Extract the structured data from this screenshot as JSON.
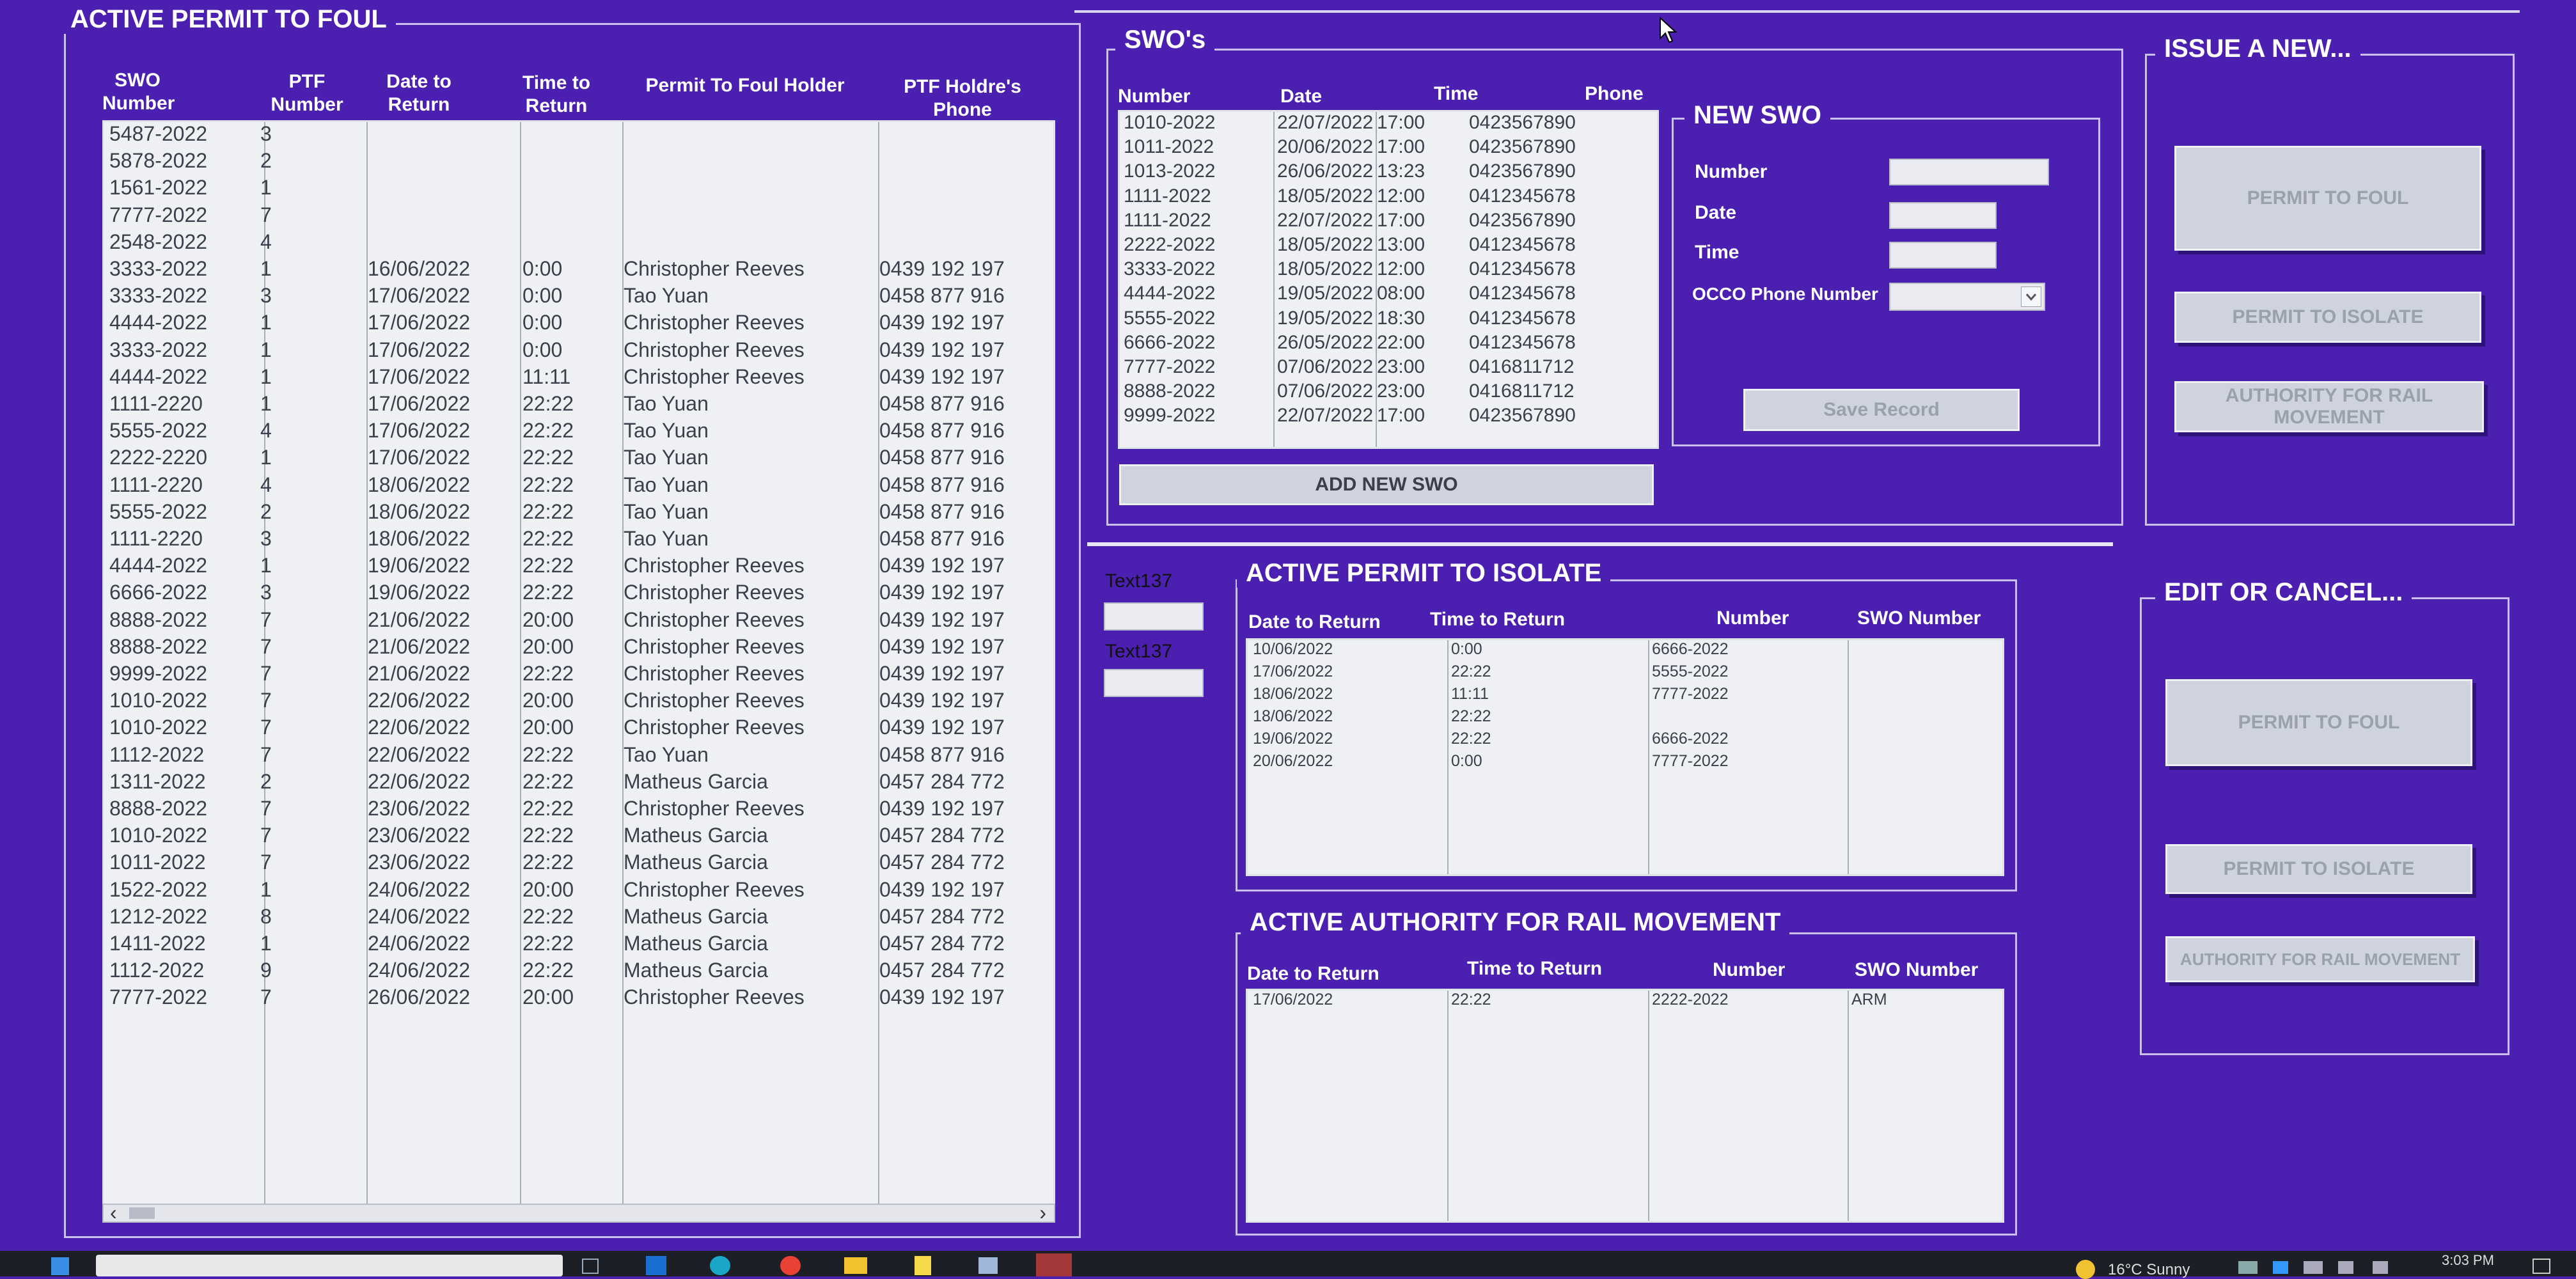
{
  "ptf": {
    "title": "ACTIVE PERMIT TO FOUL",
    "headers": [
      "SWO Number",
      "PTF Number",
      "Date to Return",
      "Time to Return",
      "Permit To Foul Holder",
      "PTF Holdre's Phone"
    ],
    "rows": [
      [
        "5487-2022",
        "3",
        "",
        "",
        "",
        ""
      ],
      [
        "5878-2022",
        "2",
        "",
        "",
        "",
        ""
      ],
      [
        "1561-2022",
        "1",
        "",
        "",
        "",
        ""
      ],
      [
        "7777-2022",
        "7",
        "",
        "",
        "",
        ""
      ],
      [
        "2548-2022",
        "4",
        "",
        "",
        "",
        ""
      ],
      [
        "3333-2022",
        "1",
        "16/06/2022",
        "0:00",
        "Christopher Reeves",
        "0439 192 197"
      ],
      [
        "3333-2022",
        "3",
        "17/06/2022",
        "0:00",
        "Tao Yuan",
        "0458 877 916"
      ],
      [
        "4444-2022",
        "1",
        "17/06/2022",
        "0:00",
        "Christopher Reeves",
        "0439 192 197"
      ],
      [
        "3333-2022",
        "1",
        "17/06/2022",
        "0:00",
        "Christopher Reeves",
        "0439 192 197"
      ],
      [
        "4444-2022",
        "1",
        "17/06/2022",
        "11:11",
        "Christopher Reeves",
        "0439 192 197"
      ],
      [
        "1111-2220",
        "1",
        "17/06/2022",
        "22:22",
        "Tao Yuan",
        "0458 877 916"
      ],
      [
        "5555-2022",
        "4",
        "17/06/2022",
        "22:22",
        "Tao Yuan",
        "0458 877 916"
      ],
      [
        "2222-2220",
        "1",
        "17/06/2022",
        "22:22",
        "Tao Yuan",
        "0458 877 916"
      ],
      [
        "1111-2220",
        "4",
        "18/06/2022",
        "22:22",
        "Tao Yuan",
        "0458 877 916"
      ],
      [
        "5555-2022",
        "2",
        "18/06/2022",
        "22:22",
        "Tao Yuan",
        "0458 877 916"
      ],
      [
        "1111-2220",
        "3",
        "18/06/2022",
        "22:22",
        "Tao Yuan",
        "0458 877 916"
      ],
      [
        "4444-2022",
        "1",
        "19/06/2022",
        "22:22",
        "Christopher Reeves",
        "0439 192 197"
      ],
      [
        "6666-2022",
        "3",
        "19/06/2022",
        "22:22",
        "Christopher Reeves",
        "0439 192 197"
      ],
      [
        "8888-2022",
        "7",
        "21/06/2022",
        "20:00",
        "Christopher Reeves",
        "0439 192 197"
      ],
      [
        "8888-2022",
        "7",
        "21/06/2022",
        "20:00",
        "Christopher Reeves",
        "0439 192 197"
      ],
      [
        "9999-2022",
        "7",
        "21/06/2022",
        "22:22",
        "Christopher Reeves",
        "0439 192 197"
      ],
      [
        "1010-2022",
        "7",
        "22/06/2022",
        "20:00",
        "Christopher Reeves",
        "0439 192 197"
      ],
      [
        "1010-2022",
        "7",
        "22/06/2022",
        "20:00",
        "Christopher Reeves",
        "0439 192 197"
      ],
      [
        "1112-2022",
        "7",
        "22/06/2022",
        "22:22",
        "Tao Yuan",
        "0458 877 916"
      ],
      [
        "1311-2022",
        "2",
        "22/06/2022",
        "22:22",
        "Matheus Garcia",
        "0457 284 772"
      ],
      [
        "8888-2022",
        "7",
        "23/06/2022",
        "22:22",
        "Christopher Reeves",
        "0439 192 197"
      ],
      [
        "1010-2022",
        "7",
        "23/06/2022",
        "22:22",
        "Matheus Garcia",
        "0457 284 772"
      ],
      [
        "1011-2022",
        "7",
        "23/06/2022",
        "22:22",
        "Matheus Garcia",
        "0457 284 772"
      ],
      [
        "1522-2022",
        "1",
        "24/06/2022",
        "20:00",
        "Christopher Reeves",
        "0439 192 197"
      ],
      [
        "1212-2022",
        "8",
        "24/06/2022",
        "22:22",
        "Matheus Garcia",
        "0457 284 772"
      ],
      [
        "1411-2022",
        "1",
        "24/06/2022",
        "22:22",
        "Matheus Garcia",
        "0457 284 772"
      ],
      [
        "1112-2022",
        "9",
        "24/06/2022",
        "22:22",
        "Matheus Garcia",
        "0457 284 772"
      ],
      [
        "7777-2022",
        "7",
        "26/06/2022",
        "20:00",
        "Christopher Reeves",
        "0439 192 197"
      ]
    ],
    "scroll_left": "‹",
    "scroll_right": "›"
  },
  "swo": {
    "title": "SWO's",
    "headers": [
      "Number",
      "Date",
      "Time",
      "Phone"
    ],
    "rows": [
      [
        "1010-2022",
        "22/07/2022",
        "17:00",
        "0423567890"
      ],
      [
        "1011-2022",
        "20/06/2022",
        "17:00",
        "0423567890"
      ],
      [
        "1013-2022",
        "26/06/2022",
        "13:23",
        "0423567890"
      ],
      [
        "1111-2022",
        "18/05/2022",
        "12:00",
        "0412345678"
      ],
      [
        "1111-2022",
        "22/07/2022",
        "17:00",
        "0423567890"
      ],
      [
        "2222-2022",
        "18/05/2022",
        "13:00",
        "0412345678"
      ],
      [
        "3333-2022",
        "18/05/2022",
        "12:00",
        "0412345678"
      ],
      [
        "4444-2022",
        "19/05/2022",
        "08:00",
        "0412345678"
      ],
      [
        "5555-2022",
        "19/05/2022",
        "18:30",
        "0412345678"
      ],
      [
        "6666-2022",
        "26/05/2022",
        "22:00",
        "0412345678"
      ],
      [
        "7777-2022",
        "07/06/2022",
        "23:00",
        "0416811712"
      ],
      [
        "8888-2022",
        "07/06/2022",
        "23:00",
        "0416811712"
      ],
      [
        "9999-2022",
        "22/07/2022",
        "17:00",
        "0423567890"
      ]
    ],
    "add_button": "ADD NEW SWO"
  },
  "new_swo": {
    "title": "NEW SWO",
    "labels": [
      "Number",
      "Date",
      "Time",
      "OCCO Phone Number"
    ],
    "dropdown_icon": "chevron-down",
    "save_button": "Save Record"
  },
  "issue": {
    "title": "ISSUE A NEW...",
    "buttons": [
      "PERMIT TO FOUL",
      "PERMIT TO ISOLATE",
      "AUTHORITY FOR RAIL MOVEMENT"
    ]
  },
  "edit": {
    "title": "EDIT OR CANCEL...",
    "buttons": [
      "PERMIT TO FOUL",
      "PERMIT TO ISOLATE",
      "AUTHORITY FOR RAIL MOVEMENT"
    ]
  },
  "text_fields": [
    "Text137",
    "Text137"
  ],
  "pti": {
    "title": "ACTIVE PERMIT TO ISOLATE",
    "headers": [
      "Date to Return",
      "Time to Return",
      "Number",
      "SWO Number"
    ],
    "rows": [
      [
        "10/06/2022",
        "0:00",
        "6666-2022",
        ""
      ],
      [
        "17/06/2022",
        "22:22",
        "5555-2022",
        ""
      ],
      [
        "18/06/2022",
        "11:11",
        "7777-2022",
        ""
      ],
      [
        "18/06/2022",
        "22:22",
        "",
        ""
      ],
      [
        "19/06/2022",
        "22:22",
        "6666-2022",
        ""
      ],
      [
        "20/06/2022",
        "0:00",
        "7777-2022",
        ""
      ]
    ]
  },
  "arm": {
    "title": "ACTIVE AUTHORITY FOR RAIL MOVEMENT",
    "headers": [
      "Date to Return",
      "Time to Return",
      "Number",
      "SWO Number"
    ],
    "rows": [
      [
        "17/06/2022",
        "22:22",
        "2222-2022",
        "ARM"
      ]
    ]
  },
  "taskbar": {
    "weather": "16°C  Sunny",
    "clock": "3:03 PM"
  }
}
